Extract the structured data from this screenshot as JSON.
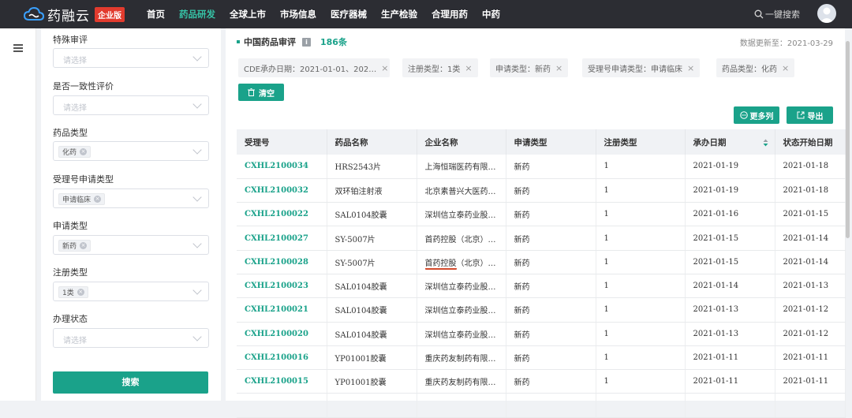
{
  "brand": {
    "name": "药融云",
    "badge": "企业版"
  },
  "nav": {
    "items": [
      "首页",
      "药品研发",
      "全球上市",
      "市场信息",
      "医疗器械",
      "生产检验",
      "合理用药",
      "中药"
    ],
    "active_index": 1
  },
  "search": {
    "label": "一键搜索"
  },
  "filters": {
    "groups": [
      {
        "label": "特殊审评",
        "placeholder": "请选择",
        "tag": ""
      },
      {
        "label": "是否一致性评价",
        "placeholder": "请选择",
        "tag": ""
      },
      {
        "label": "药品类型",
        "placeholder": "",
        "tag": "化药"
      },
      {
        "label": "受理号申请类型",
        "placeholder": "",
        "tag": "申请临床"
      },
      {
        "label": "申请类型",
        "placeholder": "",
        "tag": "新药"
      },
      {
        "label": "注册类型",
        "placeholder": "",
        "tag": "1类"
      },
      {
        "label": "办理状态",
        "placeholder": "请选择",
        "tag": ""
      }
    ],
    "search_button": "搜索"
  },
  "main": {
    "title": "中国药品审评",
    "count": "186条",
    "update_text": "数据更新至：2021-03-29",
    "chips": [
      "CDE承办日期：2021-01-01、202…",
      "注册类型：1类",
      "申请类型：新药",
      "受理号申请类型：申请临床",
      "药品类型：化药"
    ],
    "clear_button": "清空",
    "more_columns_button": "更多列",
    "export_button": "导出"
  },
  "table": {
    "headers": [
      "受理号",
      "药品名称",
      "企业名称",
      "申请类型",
      "注册类型",
      "承办日期",
      "状态开始日期"
    ],
    "rows": [
      [
        "CXHL2100034",
        "HRS2543片",
        "上海恒瑞医药有限…",
        "新药",
        "1",
        "2021-01-19",
        "2021-01-18"
      ],
      [
        "CXHL2100032",
        "双环铂注射液",
        "北京素普兴大医药…",
        "新药",
        "1",
        "2021-01-19",
        "2021-01-18"
      ],
      [
        "CXHL2100022",
        "SAL0104胶囊",
        "深圳信立泰药业股…",
        "新药",
        "1",
        "2021-01-16",
        "2021-01-15"
      ],
      [
        "CXHL2100027",
        "SY-5007片",
        "首药控股（北京）…",
        "新药",
        "1",
        "2021-01-15",
        "2021-01-14"
      ],
      [
        "CXHL2100028",
        "SY-5007片",
        "首药控股（北京）…",
        "新药",
        "1",
        "2021-01-15",
        "2021-01-14"
      ],
      [
        "CXHL2100023",
        "SAL0104胶囊",
        "深圳信立泰药业股…",
        "新药",
        "1",
        "2021-01-14",
        "2021-01-13"
      ],
      [
        "CXHL2100021",
        "SAL0104胶囊",
        "深圳信立泰药业股…",
        "新药",
        "1",
        "2021-01-13",
        "2021-01-12"
      ],
      [
        "CXHL2100020",
        "SAL0104胶囊",
        "深圳信立泰药业股…",
        "新药",
        "1",
        "2021-01-13",
        "2021-01-12"
      ],
      [
        "CXHL2100016",
        "YP01001胶囊",
        "重庆药友制药有限…",
        "新药",
        "1",
        "2021-01-11",
        "2021-01-11"
      ],
      [
        "CXHL2100015",
        "YP01001胶囊",
        "重庆药友制药有限…",
        "新药",
        "1",
        "2021-01-11",
        "2021-01-11"
      ],
      [
        "",
        "",
        "",
        "",
        "",
        "",
        ""
      ]
    ]
  },
  "colors": {
    "accent": "#1aa28a",
    "topbar": "#2c2d33",
    "badge": "#e23b2e",
    "annotation": "#d24a2c"
  }
}
